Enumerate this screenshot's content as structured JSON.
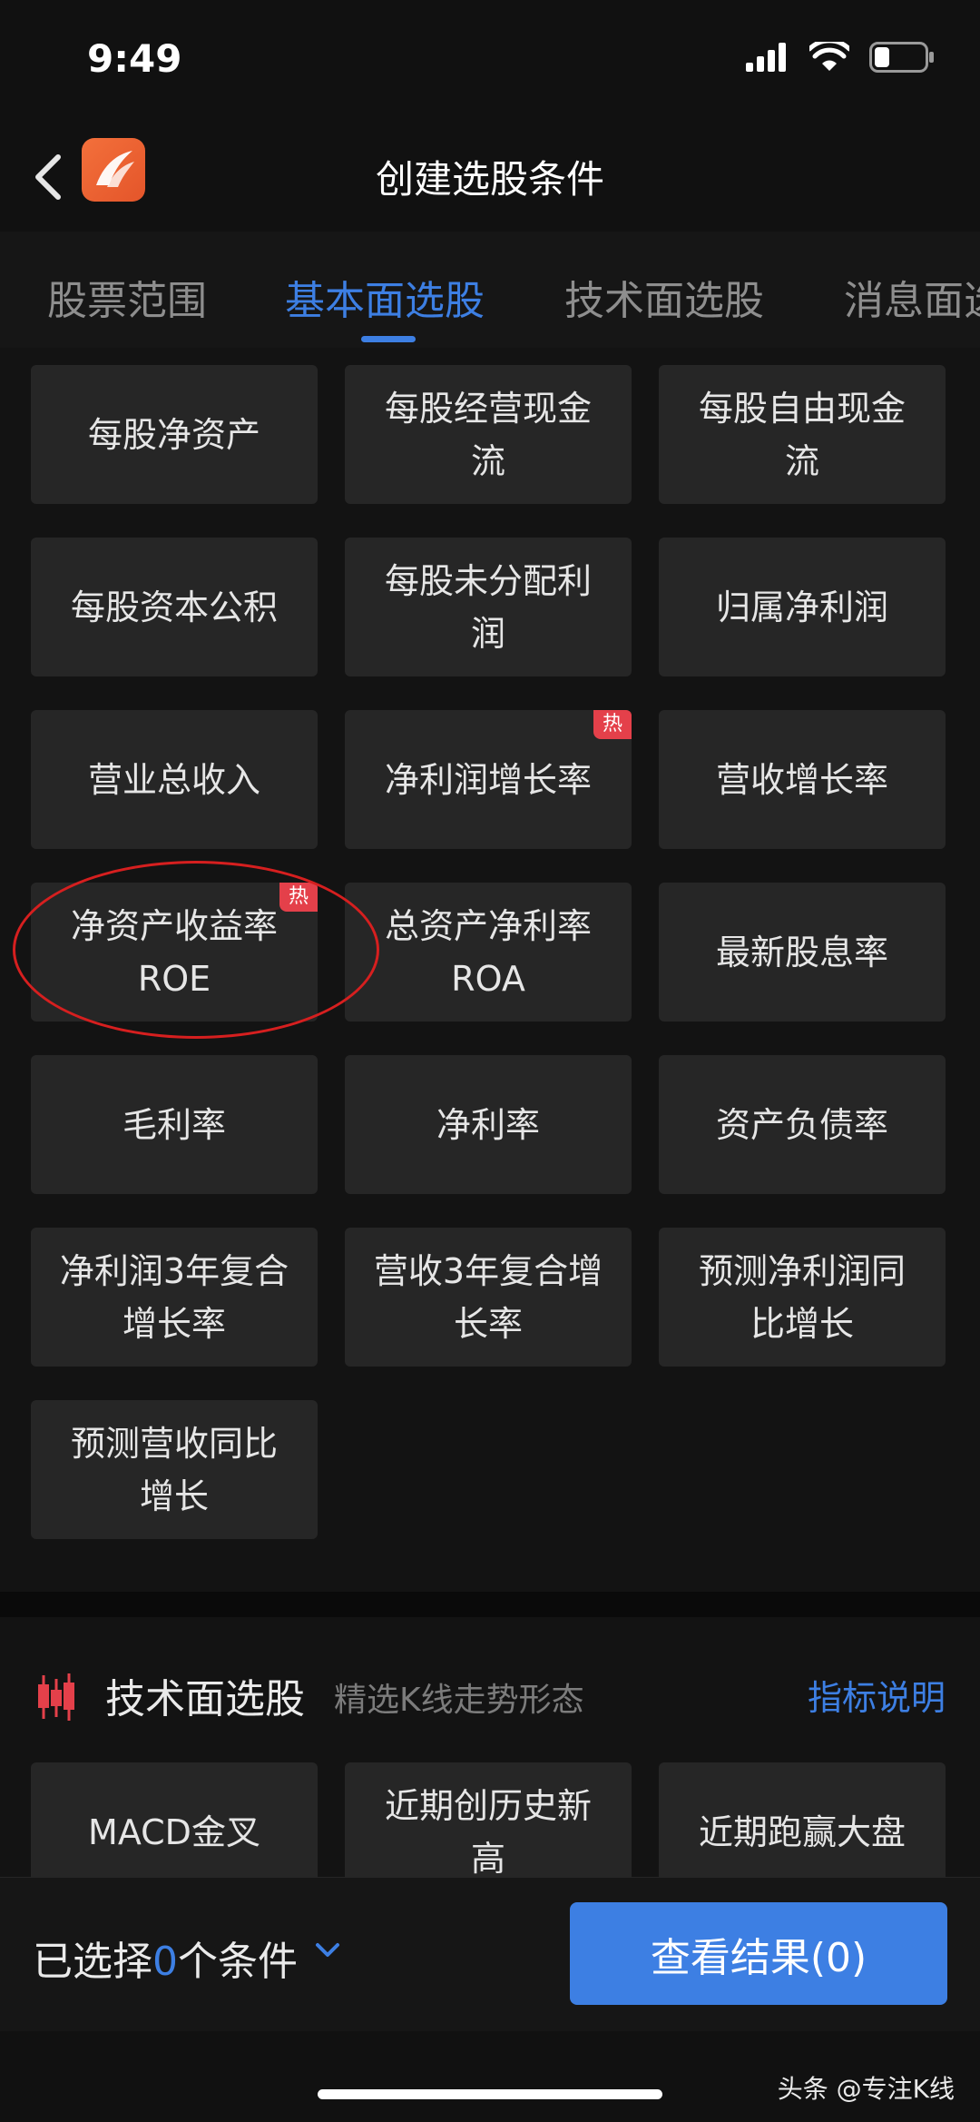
{
  "status_bar": {
    "time": "9:49"
  },
  "header": {
    "title": "创建选股条件",
    "back_icon": "chevron-left-icon",
    "logo_icon": "app-logo-icon"
  },
  "tabs": [
    {
      "label": "股票范围",
      "active": false
    },
    {
      "label": "基本面选股",
      "active": true
    },
    {
      "label": "技术面选股",
      "active": false
    },
    {
      "label": "消息面选股",
      "active": false
    }
  ],
  "fundamental_items": [
    {
      "label": "每股净资产",
      "hot": false
    },
    {
      "label": "每股经营现金流",
      "hot": false
    },
    {
      "label": "每股自由现金流",
      "hot": false
    },
    {
      "label": "每股资本公积",
      "hot": false
    },
    {
      "label": "每股未分配利润",
      "hot": false
    },
    {
      "label": "归属净利润",
      "hot": false
    },
    {
      "label": "营业总收入",
      "hot": false
    },
    {
      "label": "净利润增长率",
      "hot": true
    },
    {
      "label": "营收增长率",
      "hot": false
    },
    {
      "label": "净资产收益率ROE",
      "hot": true
    },
    {
      "label": "总资产净利率ROA",
      "hot": false
    },
    {
      "label": "最新股息率",
      "hot": false
    },
    {
      "label": "毛利率",
      "hot": false
    },
    {
      "label": "净利率",
      "hot": false
    },
    {
      "label": "资产负债率",
      "hot": false
    },
    {
      "label": "净利润3年复合增长率",
      "hot": false
    },
    {
      "label": "营收3年复合增长率",
      "hot": false
    },
    {
      "label": "预测净利润同比增长",
      "hot": false
    },
    {
      "label": "预测营收同比增长",
      "hot": false
    }
  ],
  "hot_badge": "热",
  "technical_section": {
    "title": "技术面选股",
    "subtitle": "精选K线走势形态",
    "link": "指标说明",
    "icon": "candlestick-icon"
  },
  "technical_items": [
    {
      "label": "MACD金叉"
    },
    {
      "label": "近期创历史新高"
    },
    {
      "label": "近期跑赢大盘"
    }
  ],
  "bottom_bar": {
    "selected_prefix": "已选择",
    "selected_count": "0",
    "selected_suffix": "个条件",
    "result_button": "查看结果(0)"
  },
  "watermark": "头条 @专注K线",
  "colors": {
    "accent": "#3d7fe3",
    "hot": "#e4404a",
    "annotation": "#d61f1f"
  }
}
